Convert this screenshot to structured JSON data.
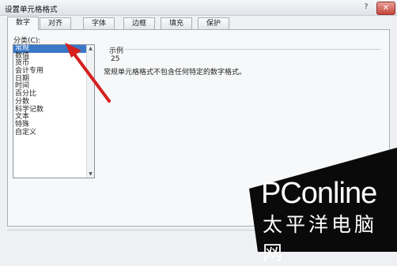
{
  "window": {
    "title": "设置单元格格式",
    "help_label": "?",
    "close_label": "✕"
  },
  "tabs": [
    {
      "label": "数字",
      "active": true
    },
    {
      "label": "对齐",
      "active": false
    },
    {
      "label": "字体",
      "active": false
    },
    {
      "label": "边框",
      "active": false
    },
    {
      "label": "填充",
      "active": false
    },
    {
      "label": "保护",
      "active": false
    }
  ],
  "category": {
    "label": "分类(C):",
    "selected": "常规",
    "items": [
      "常规",
      "数值",
      "货币",
      "会计专用",
      "日期",
      "时间",
      "百分比",
      "分数",
      "科学记数",
      "文本",
      "特殊",
      "自定义"
    ]
  },
  "sample": {
    "label": "示例",
    "value": "25"
  },
  "description": "常规单元格格式不包含任何特定的数字格式。",
  "watermark": {
    "en": "PConline",
    "zh": "太平洋电脑网"
  },
  "colors": {
    "selection": "#3a78c8",
    "arrow": "#d62020",
    "close_button": "#c6463a"
  }
}
